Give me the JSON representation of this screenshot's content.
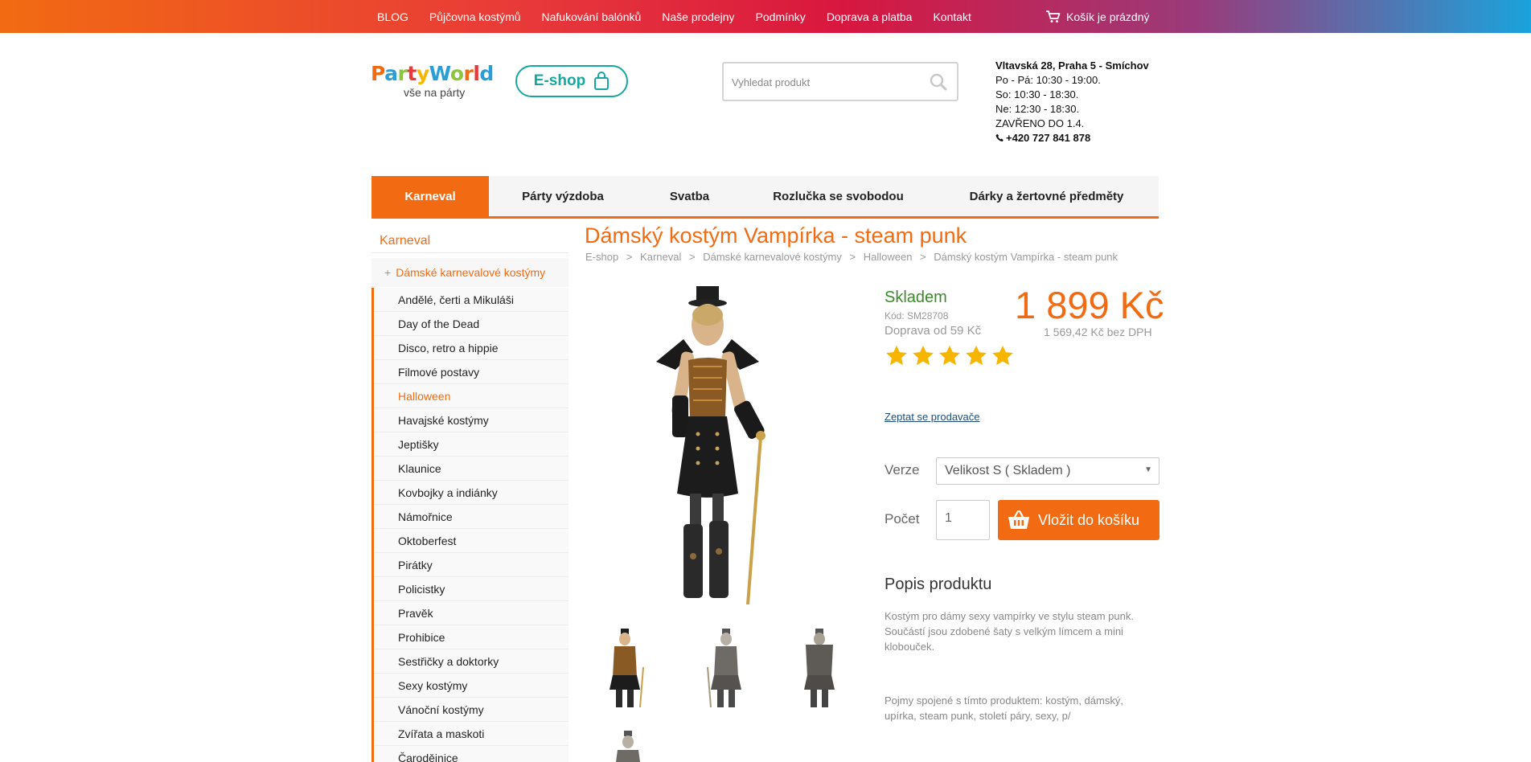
{
  "topnav": {
    "items": [
      "BLOG",
      "Půjčovna kostýmů",
      "Nafukování balónků",
      "Naše prodejny",
      "Podmínky",
      "Doprava a platba",
      "Kontakt"
    ],
    "cart_label": "Košík je prázdný"
  },
  "header": {
    "logo_sub": "vše na párty",
    "eshop_label": "E-shop",
    "search_placeholder": "Vyhledat produkt",
    "store": {
      "address": "Vltavská 28, Praha 5 - Smíchov",
      "hours": [
        "Po - Pá: 10:30 - 19:00.",
        "So: 10:30 - 18:30.",
        "Ne: 12:30 - 18:30.",
        "ZAVŘENO DO 1.4."
      ],
      "phone": "+420 727 841 878"
    }
  },
  "mainnav": {
    "items": [
      "Karneval",
      "Párty výzdoba",
      "Svatba",
      "Rozlučka se svobodou",
      "Dárky a žertovné předměty"
    ],
    "active": "Karneval"
  },
  "sidebar": {
    "title": "Karneval",
    "category": "Dámské karnevalové kostýmy",
    "items": [
      "Andělé, čerti a Mikuláši",
      "Day of the Dead",
      "Disco, retro a hippie",
      "Filmové postavy",
      "Halloween",
      "Havajské kostýmy",
      "Jeptišky",
      "Klaunice",
      "Kovbojky a indiánky",
      "Námořnice",
      "Oktoberfest",
      "Pirátky",
      "Policistky",
      "Pravěk",
      "Prohibice",
      "Sestřičky a doktorky",
      "Sexy kostýmy",
      "Vánoční kostýmy",
      "Zvířata a maskoti",
      "Čarodějnice"
    ],
    "active": "Halloween"
  },
  "product": {
    "title": "Dámský kostým Vampírka - steam punk",
    "breadcrumb": [
      "E-shop",
      ">",
      "Karneval",
      ">",
      "Dámské karnevalové kostýmy",
      ">",
      "Halloween",
      ">",
      "Dámský kostým Vampírka - steam punk"
    ],
    "stock": "Skladem",
    "code": "Kód: SM28708",
    "shipping": "Doprava od 59 Kč",
    "price": "1 899 Kč",
    "price_nodph": "1 569,42 Kč bez DPH",
    "rating": 5,
    "ask_link": "Zeptat se prodavače",
    "version_label": "Verze",
    "version_value": "Velikost S ( Skladem )",
    "qty_label": "Počet",
    "qty_value": "1",
    "add_to_cart": "Vložit do košíku",
    "desc_title": "Popis produktu",
    "desc_text": "Kostým pro dámy sexy vampírky ve stylu steam punk. Součástí jsou zdobené šaty s velkým límcem a mini klobouček.",
    "terms_text": "Pojmy spojené s tímto produktem: kostým, dámský, upírka, steam punk, století páry, sexy, p/"
  },
  "colors": {
    "accent": "#f26b12",
    "stock_green": "#3a8a2a",
    "eshop_teal": "#17a6a0",
    "star": "#f7b500"
  },
  "icons": {
    "cart": "cart-icon",
    "search": "search-icon",
    "bag": "shopping-bag-icon",
    "phone": "phone-icon",
    "star": "star-icon",
    "basket": "basket-icon"
  }
}
